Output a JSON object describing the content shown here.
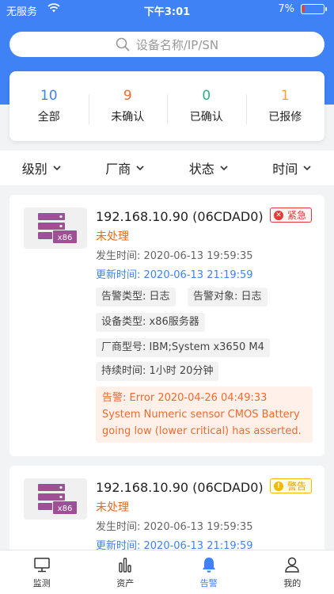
{
  "status_bar": {
    "carrier": "无服务",
    "time": "下午3:01",
    "battery": "7%"
  },
  "search": {
    "placeholder": "设备名称/IP/SN"
  },
  "summary": [
    {
      "count": "10",
      "label": "全部",
      "color": "#3f82f6"
    },
    {
      "count": "9",
      "label": "未确认",
      "color": "#ef6a2e"
    },
    {
      "count": "0",
      "label": "已确认",
      "color": "#2bb07f"
    },
    {
      "count": "1",
      "label": "已报修",
      "color": "#f5a623"
    }
  ],
  "filters": [
    "级别",
    "厂商",
    "状态",
    "时间"
  ],
  "cards": [
    {
      "ip": "192.168.10.90 (06CDAD0)",
      "badge": "紧急",
      "state": "未处理",
      "occur": "发生时间:  2020-06-13 19:59:35",
      "update": "更新时间:  2020-06-13 21:19:59",
      "alarm_type": "告警类型:  日志",
      "alarm_target": "告警对象:  日志",
      "device_type": "设备类型:  x86服务器",
      "vendor_model": "厂商型号:  IBM;System x3650 M4",
      "duration": "持续时间:  1小时 20分钟",
      "message": "告警: Error 2020-04-26 04:49:33 System Numeric sensor CMOS Battery going low (lower critical) has asserted."
    },
    {
      "ip": "192.168.10.90 (06CDAD0)",
      "badge": "警告",
      "state": "未处理",
      "occur": "发生时间:  2020-06-13 19:59:35",
      "update": "更新时间:  2020-06-13 21:19:59"
    }
  ],
  "server_icon_label": "x86",
  "tabs": [
    {
      "label": "监测",
      "icon": "monitor-icon"
    },
    {
      "label": "资产",
      "icon": "bar-chart-icon"
    },
    {
      "label": "告警",
      "icon": "bell-icon"
    },
    {
      "label": "我的",
      "icon": "user-icon"
    }
  ],
  "colors": {
    "primary": "#3f82f6",
    "urgent": "#e53935",
    "warn": "#f5b800",
    "pending": "#e86a1a",
    "server_icon": "#a04e96"
  }
}
